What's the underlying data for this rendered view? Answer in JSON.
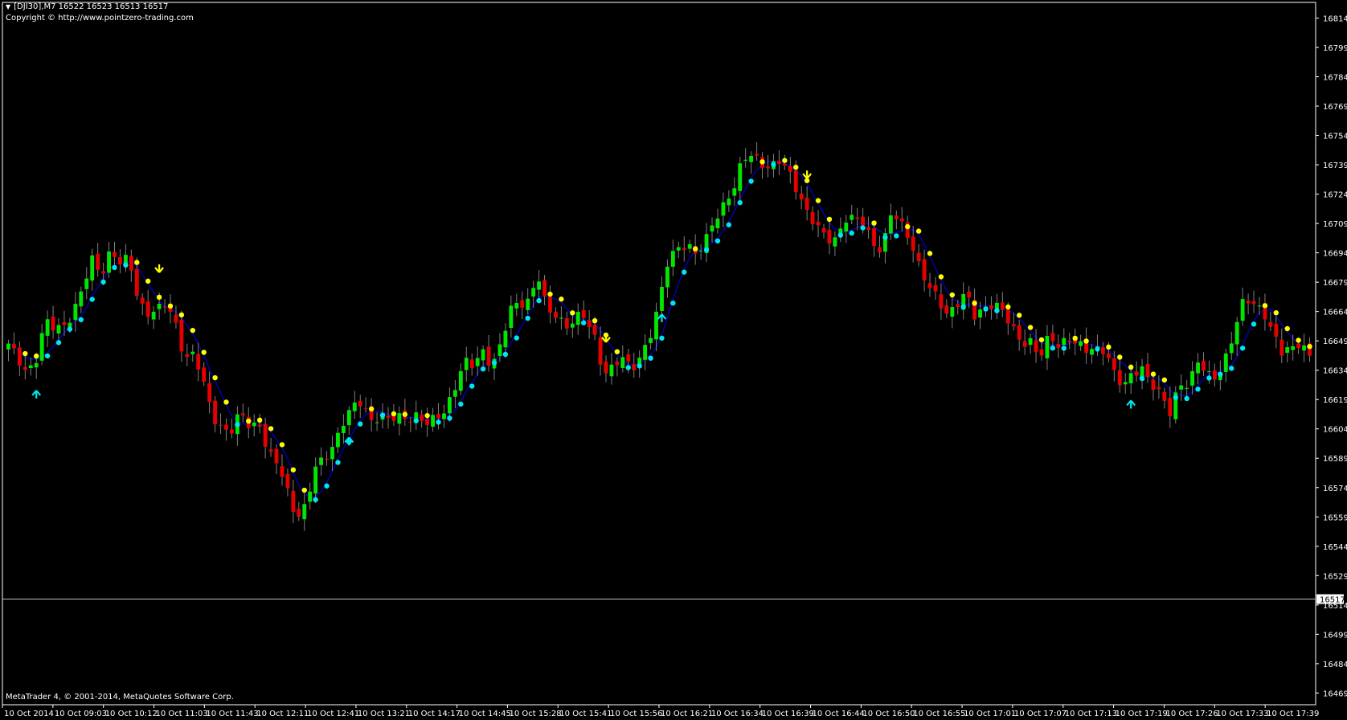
{
  "header": {
    "symbol_line": "[DJI30],M7  16522 16523 16513 16517",
    "menu_icon": "triangle-down-icon",
    "copyright": "Copyright © http://www.pointzero-trading.com"
  },
  "footer": {
    "text": "MetaTrader 4, © 2001-2014, MetaQuotes Software Corp."
  },
  "colors": {
    "background": "#000000",
    "axis": "#ffffff",
    "bull_candle": "#00e600",
    "bear_candle": "#e60000",
    "wick": "#808080",
    "trend_line": "#0000cc",
    "dot_up": "#00e5ee",
    "dot_down": "#ffff00",
    "arrow_up": "#00e5ee",
    "arrow_down": "#ffff00",
    "price_line": "#c0c0c0"
  },
  "chart_data": {
    "type": "candlestick",
    "symbol": "DJI30",
    "timeframe": "M7",
    "ylim": [
      16463,
      16822
    ],
    "y_ticks": [
      16814,
      16799,
      16784,
      16769,
      16754,
      16739,
      16724,
      16709,
      16694,
      16679,
      16664,
      16649,
      16634,
      16619,
      16604,
      16589,
      16574,
      16559,
      16544,
      16529,
      16514,
      16499,
      16484,
      16469
    ],
    "current_price": 16517,
    "x_labels": [
      "10 Oct 2014",
      "10 Oct 09:03",
      "10 Oct 10:12",
      "10 Oct 11:03",
      "10 Oct 11:43",
      "10 Oct 12:11",
      "10 Oct 12:41",
      "10 Oct 13:21",
      "10 Oct 14:17",
      "10 Oct 14:45",
      "10 Oct 15:28",
      "10 Oct 15:41",
      "10 Oct 15:56",
      "10 Oct 16:21",
      "10 Oct 16:34",
      "10 Oct 16:39",
      "10 Oct 16:44",
      "10 Oct 16:50",
      "10 Oct 16:55",
      "10 Oct 17:01",
      "10 Oct 17:07",
      "10 Oct 17:13",
      "10 Oct 17:19",
      "10 Oct 17:26",
      "10 Oct 17:33",
      "10 Oct 17:39"
    ],
    "close_path": [
      16646,
      16640,
      16634,
      16640,
      16658,
      16655,
      16658,
      16664,
      16675,
      16690,
      16684,
      16696,
      16688,
      16690,
      16670,
      16664,
      16664,
      16667,
      16658,
      16641,
      16642,
      16626,
      16611,
      16605,
      16603,
      16611,
      16605,
      16608,
      16591,
      16585,
      16572,
      16560,
      16565,
      16583,
      16588,
      16597,
      16608,
      16614,
      16617,
      16609,
      16612,
      16608,
      16609,
      16610,
      16612,
      16606,
      16608,
      16614,
      16626,
      16638,
      16635,
      16644,
      16638,
      16647,
      16664,
      16668,
      16671,
      16683,
      16662,
      16662,
      16657,
      16662,
      16660,
      16651,
      16634,
      16636,
      16640,
      16633,
      16642,
      16652,
      16667,
      16690,
      16697,
      16700,
      16692,
      16699,
      16712,
      16720,
      16726,
      16740,
      16745,
      16741,
      16737,
      16740,
      16735,
      16726,
      16714,
      16706,
      16701,
      16702,
      16712,
      16710,
      16709,
      16700,
      16696,
      16714,
      16708,
      16702,
      16688,
      16676,
      16669,
      16663,
      16669,
      16673,
      16660,
      16666,
      16670,
      16664,
      16654,
      16648,
      16650,
      16641,
      16650,
      16646,
      16652,
      16648,
      16643,
      16644,
      16646,
      16633,
      16624,
      16632,
      16636,
      16628,
      16620,
      16611,
      16628,
      16628,
      16638,
      16630,
      16631,
      16642,
      16655,
      16670,
      16668,
      16666,
      16653,
      16642,
      16645,
      16650,
      16641
    ],
    "signals": [
      {
        "type": "buy",
        "bar": 5
      },
      {
        "type": "sell",
        "bar": 27
      },
      {
        "type": "buy",
        "bar": 61
      },
      {
        "type": "sell",
        "bar": 107
      },
      {
        "type": "buy",
        "bar": 117
      },
      {
        "type": "sell",
        "bar": 143
      },
      {
        "type": "buy",
        "bar": 201
      }
    ]
  }
}
